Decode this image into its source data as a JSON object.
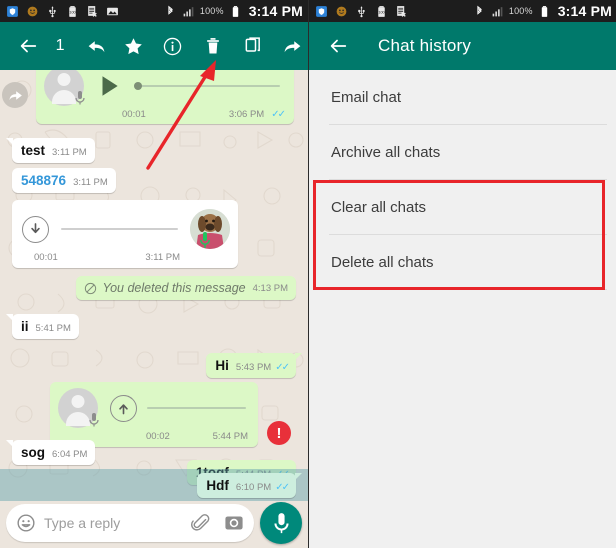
{
  "meta": {
    "accent_teal": "#00796b",
    "chat_bg": "#ece5dd",
    "out_bubble": "#dcf8c6",
    "in_bubble": "#ffffff",
    "highlight_red": "#e8252a",
    "selection_overlay": "rgba(93,160,170,0.45)"
  },
  "status_bar": {
    "time": "3:14 PM",
    "battery_percent": "100%",
    "icons_left": [
      "shield-icon",
      "emoji-face-icon",
      "usb-icon",
      "battery-saver-icon",
      "document-x-icon",
      "image-icon"
    ],
    "icons_right": [
      "bluetooth-icon",
      "signal-bars-icon",
      "battery-icon"
    ]
  },
  "left_panel": {
    "toolbar": {
      "back_label": "←",
      "selected_count": "1",
      "actions": [
        "reply-icon",
        "star-icon",
        "info-icon",
        "delete-icon",
        "copy-icon",
        "forward-icon"
      ]
    },
    "compose": {
      "placeholder": "Type a reply",
      "emoji_icon": "emoji-icon",
      "attach_icon": "paperclip-icon",
      "camera_icon": "camera-icon",
      "mic_icon": "microphone-icon"
    },
    "messages": [
      {
        "id": "m1",
        "kind": "voice-out",
        "forwarded": true,
        "duration": "00:01",
        "time": "3:06 PM",
        "ticks": "✓✓",
        "state": "played"
      },
      {
        "id": "m2",
        "kind": "text-in",
        "text": "test",
        "time": "3:11 PM"
      },
      {
        "id": "m3",
        "kind": "text-in",
        "text": "548876",
        "time": "3:11 PM",
        "style": "link"
      },
      {
        "id": "m4",
        "kind": "voice-in",
        "duration": "00:01",
        "time": "3:11 PM",
        "state": "download"
      },
      {
        "id": "m5",
        "kind": "deleted-out",
        "text": "You deleted this message",
        "time": "4:13 PM"
      },
      {
        "id": "m6",
        "kind": "text-in",
        "text": "ii",
        "time": "5:41 PM"
      },
      {
        "id": "m7",
        "kind": "text-out",
        "text": "Hi",
        "time": "5:43 PM",
        "ticks": "✓✓"
      },
      {
        "id": "m8",
        "kind": "voice-out",
        "duration": "00:02",
        "time": "5:44 PM",
        "state": "upload",
        "error": true
      },
      {
        "id": "m9",
        "kind": "text-out",
        "text": "1togf",
        "time": "5:44 PM",
        "ticks": "✓✓"
      },
      {
        "id": "m10",
        "kind": "text-in",
        "text": "sog",
        "time": "6:04 PM"
      },
      {
        "id": "m11",
        "kind": "text-out",
        "text": "Hdf",
        "time": "6:10 PM",
        "ticks": "✓✓",
        "selected": true
      }
    ]
  },
  "right_panel": {
    "header": {
      "back_icon": "back-arrow-icon",
      "title": "Chat history"
    },
    "menu_items": [
      {
        "label": "Email chat",
        "highlighted": false
      },
      {
        "label": "Archive all chats",
        "highlighted": false
      },
      {
        "label": "Clear all chats",
        "highlighted": true
      },
      {
        "label": "Delete all chats",
        "highlighted": true
      }
    ]
  },
  "annotations": {
    "arrow_target": "delete-icon",
    "highlight_box_items": [
      "Clear all chats",
      "Delete all chats"
    ]
  }
}
